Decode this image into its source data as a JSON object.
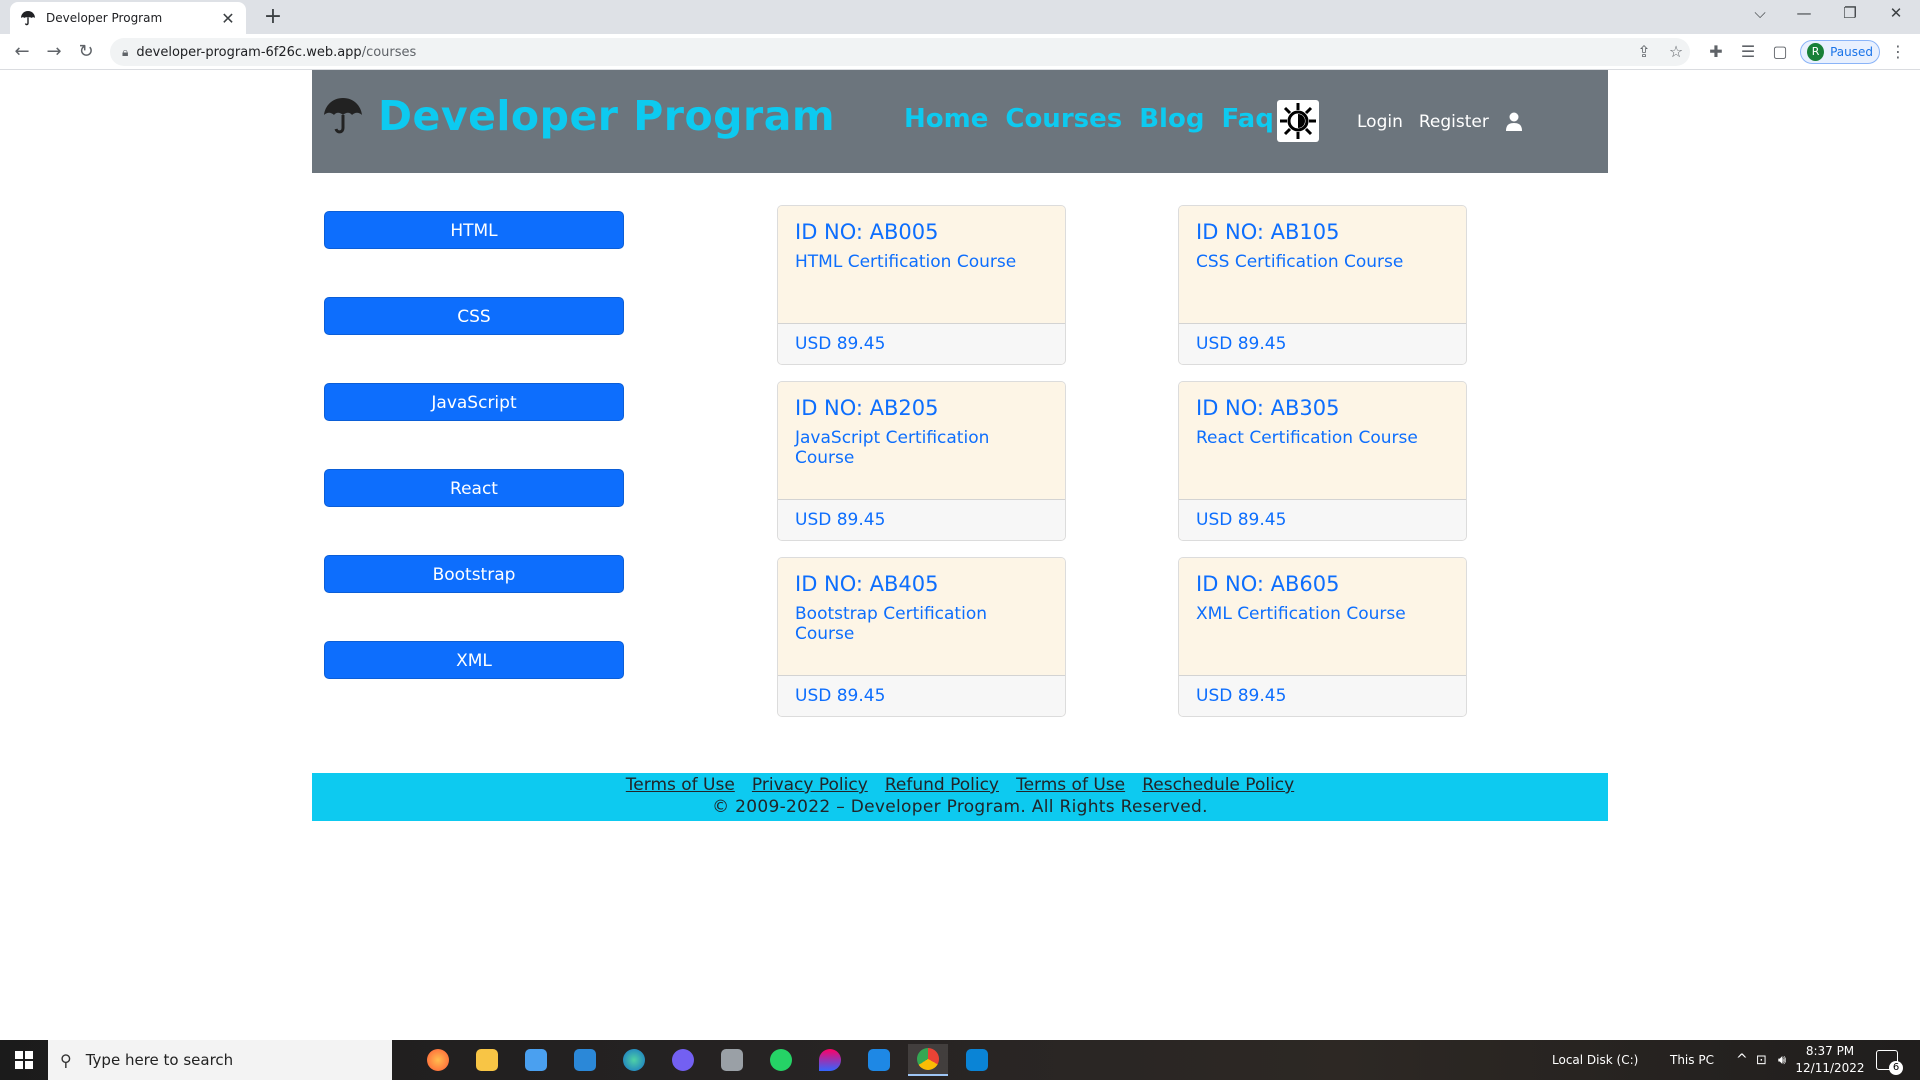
{
  "browser": {
    "tab_title": "Developer Program",
    "new_tab_label": "+",
    "url_host": "developer-program-6f26c.web.app",
    "url_path": "/courses",
    "profile_initial": "R",
    "profile_status": "Paused"
  },
  "header": {
    "brand": "Developer Program",
    "nav": [
      "Home",
      "Courses",
      "Blog",
      "Faq"
    ],
    "login": "Login",
    "register": "Register"
  },
  "categories": [
    "HTML",
    "CSS",
    "JavaScript",
    "React",
    "Bootstrap",
    "XML"
  ],
  "courses": [
    {
      "id": "ID NO: AB005",
      "name": "HTML Certification Course",
      "price": "USD 89.45"
    },
    {
      "id": "ID NO: AB105",
      "name": "CSS Certification Course",
      "price": "USD 89.45"
    },
    {
      "id": "ID NO: AB205",
      "name": "JavaScript Certification Course",
      "price": "USD 89.45"
    },
    {
      "id": "ID NO: AB305",
      "name": "React Certification Course",
      "price": "USD 89.45"
    },
    {
      "id": "ID NO: AB405",
      "name": "Bootstrap Certification Course",
      "price": "USD 89.45"
    },
    {
      "id": "ID NO: AB605",
      "name": "XML Certification Course",
      "price": "USD 89.45"
    }
  ],
  "footer": {
    "links": [
      "Terms of Use",
      "Privacy Policy",
      "Refund Policy",
      "Terms of Use",
      "Reschedule Policy"
    ],
    "copyright": "© 2009-2022 – Developer Program. All Rights Reserved."
  },
  "taskbar": {
    "search_placeholder": "Type here to search",
    "tray_local_disk": "Local Disk (C:)",
    "tray_this_pc": "This PC",
    "time": "8:37 PM",
    "date": "12/11/2022",
    "notification_count": "6"
  },
  "colors": {
    "header_bg": "#6c757d",
    "brand": "#0dcaf0",
    "primary": "#0d6efd",
    "card_bg": "#fdf5e6",
    "footer_bg": "#0dcaf0"
  }
}
